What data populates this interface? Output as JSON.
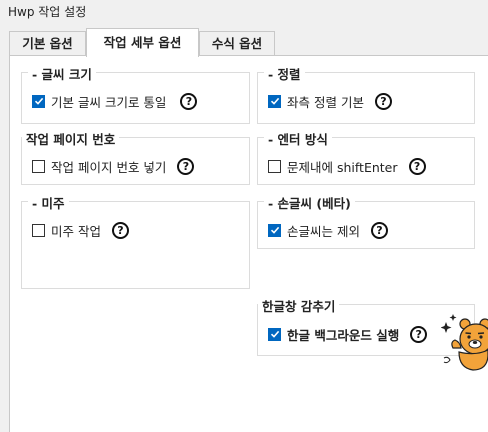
{
  "window": {
    "title": "Hwp 작업 설정"
  },
  "tabs": [
    {
      "label": "기본 옵션",
      "active": false
    },
    {
      "label": "작업 세부 옵션",
      "active": true
    },
    {
      "label": "수식 옵션",
      "active": false
    }
  ],
  "groups": {
    "font_size": {
      "title": "- 글씨 크기",
      "option": "기본 글씨 크기로 통일",
      "checked": true
    },
    "align": {
      "title": "- 정렬",
      "option": "좌측 정렬 기본",
      "checked": true
    },
    "page_number": {
      "title": "작업 페이지 번호",
      "option": "작업 페이지 번호 넣기",
      "checked": false
    },
    "enter_mode": {
      "title": "- 엔터 방식",
      "option": "문제내에 shiftEnter",
      "checked": false
    },
    "footnote": {
      "title": "- 미주",
      "option": "미주 작업",
      "checked": false
    },
    "handwriting": {
      "title": "- 손글씨 (베타)",
      "option": "손글씨는 제외",
      "checked": true
    },
    "hide_hangul": {
      "title": "한글창 감추기",
      "option": "한글 백그라운드 실행",
      "checked": true
    }
  },
  "help_glyph": "?",
  "icons": {
    "help": "help-circle-icon",
    "check": "checkmark-icon",
    "mascot": "mascot-icon"
  },
  "colors": {
    "accent": "#0067c0",
    "background": "#f0f0f0",
    "panel": "#ffffff",
    "border": "#dcdcdc"
  }
}
